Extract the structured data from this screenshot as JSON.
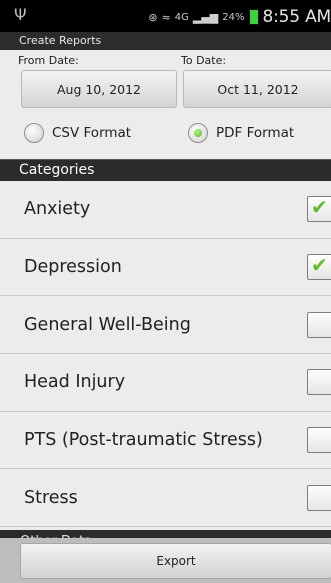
{
  "status_bar": {
    "usb_icon": "usb-icon",
    "signal_text": "4G",
    "battery_percent": "24%",
    "time": "8:55 AM"
  },
  "title": "Create Reports",
  "dates": {
    "from_label": "From Date:",
    "to_label": "To Date:",
    "from_value": "Aug 10, 2012",
    "to_value": "Oct 11, 2012"
  },
  "formats": {
    "csv_label": "CSV Format",
    "pdf_label": "PDF Format",
    "selected": "PDF Format"
  },
  "categories": {
    "header": "Categories",
    "items": [
      {
        "label": "Anxiety",
        "checked": true
      },
      {
        "label": "Depression",
        "checked": true
      },
      {
        "label": "General Well-Being",
        "checked": false
      },
      {
        "label": "Head Injury",
        "checked": false
      },
      {
        "label": "PTS (Post-traumatic Stress)",
        "checked": false
      },
      {
        "label": "Stress",
        "checked": false
      }
    ]
  },
  "other_data_header": "Other Data",
  "export_label": "Export",
  "colors": {
    "accent_check": "#5fbf2a",
    "header_bg": "#2b2b2b",
    "battery": "#3cd43c"
  }
}
